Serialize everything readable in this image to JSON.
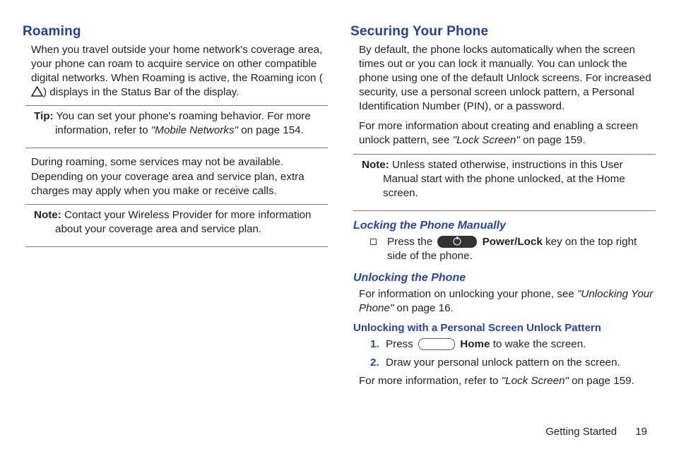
{
  "left": {
    "heading": "Roaming",
    "p1a": "When you travel outside your home network's coverage area, your phone can roam to acquire service on other compatible digital networks. When Roaming is active, the Roaming icon (",
    "p1b": ") displays in the Status Bar of the display.",
    "tip_label": "Tip:",
    "tip_a": "You can set your phone's roaming behavior. For more information, refer to ",
    "tip_ref": "\"Mobile Networks\"",
    "tip_b": " on page 154.",
    "p2": "During roaming, some services may not be available. Depending on your coverage area and service plan, extra charges may apply when you make or receive calls.",
    "note_label": "Note:",
    "note_text": "Contact your Wireless Provider for more information about your coverage area and service plan."
  },
  "right": {
    "heading": "Securing Your Phone",
    "p1": "By default, the phone locks automatically when the screen times out or you can lock it manually. You can unlock the phone using one of the default Unlock screens. For increased security, use a personal screen unlock pattern, a Personal Identification Number (PIN), or a password.",
    "p2a": "For more information about creating and enabling a screen unlock pattern, see ",
    "p2ref": "\"Lock Screen\"",
    "p2b": " on page 159.",
    "note_label": "Note:",
    "note_text": "Unless stated otherwise, instructions in this User Manual start with the phone unlocked, at the Home screen.",
    "lock_h": "Locking the Phone Manually",
    "lock_a": "Press the ",
    "lock_strong": "Power/Lock",
    "lock_b": " key on the top right side of the phone.",
    "unlock_h": "Unlocking the Phone",
    "unlock_pa": "For information on unlocking your phone, see ",
    "unlock_ref": "\"Unlocking Your Phone\"",
    "unlock_pb": " on page 16.",
    "pat_h": "Unlocking with a Personal Screen Unlock Pattern",
    "step1a": "Press ",
    "step1strong": "Home",
    "step1b": " to wake the screen.",
    "step2": "Draw your personal unlock pattern on the screen.",
    "more_a": "For more information, refer to ",
    "more_ref": "\"Lock Screen\"",
    "more_b": " on page 159."
  },
  "footer": {
    "section": "Getting Started",
    "page": "19"
  },
  "marks": {
    "n1": "1.",
    "n2": "2."
  }
}
